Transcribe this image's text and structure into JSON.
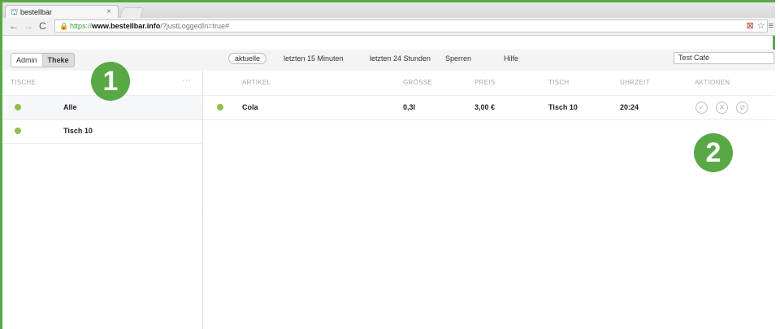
{
  "browser": {
    "tab_title": "bestellbar",
    "tab_close": "×",
    "url_scheme": "https://",
    "url_host": "www.bestellbar.info",
    "url_path": "/?justLoggedIn=true#"
  },
  "toolbar": {
    "mode_admin": "Admin",
    "mode_theke": "Theke",
    "filter_current": "aktuelle",
    "filter_15min": "letzten 15 Minuten",
    "filter_24h": "letzten 24 Stunden",
    "lock": "Sperren",
    "help": "Hilfe",
    "cafe_select": "Test Café"
  },
  "tables_panel": {
    "header": "TISCHE",
    "menu": "···",
    "items": [
      {
        "label": "Alle",
        "status_color": "#8cc04a"
      },
      {
        "label": "Tisch 10",
        "status_color": "#8cc04a"
      }
    ]
  },
  "orders": {
    "columns": [
      "ARTIKEL",
      "GRÖSSE",
      "PREIS",
      "TISCH",
      "UHRZEIT",
      "AKTIONEN"
    ],
    "rows": [
      {
        "item": "Cola",
        "size": "0,3l",
        "price": "3,00 €",
        "table": "Tisch 10",
        "time": "20:24",
        "status_color": "#8cc04a"
      }
    ]
  },
  "markers": [
    "1",
    "2"
  ],
  "colors": {
    "frame": "#5aa845",
    "status": "#8cc04a"
  }
}
